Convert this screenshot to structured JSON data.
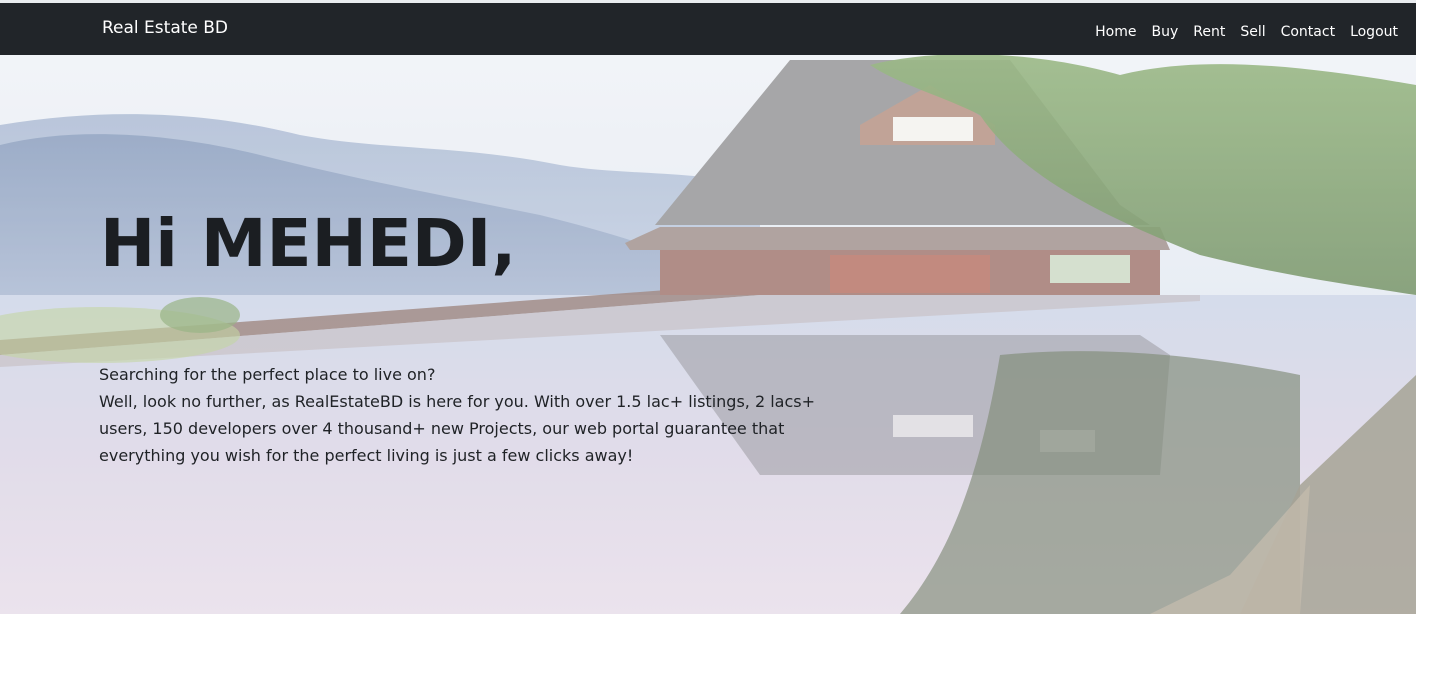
{
  "navbar": {
    "brand": "Real Estate BD",
    "links": [
      "Home",
      "Buy",
      "Rent",
      "Sell",
      "Contact",
      "Logout"
    ]
  },
  "hero": {
    "greeting": "Hi MEHEDI,",
    "question": "Searching for the perfect place to live on?",
    "description": "Well, look no further, as RealEstateBD is here for you. With over 1.5 lac+ listings, 2 lacs+ users, 150 developers over 4 thousand+ new Projects, our web portal guarantee that everything you wish for the perfect living is just a few clicks away!"
  },
  "colors": {
    "navbar_bg": "#212529",
    "nav_text": "#ffffff",
    "hero_title": "#1b1e22"
  }
}
